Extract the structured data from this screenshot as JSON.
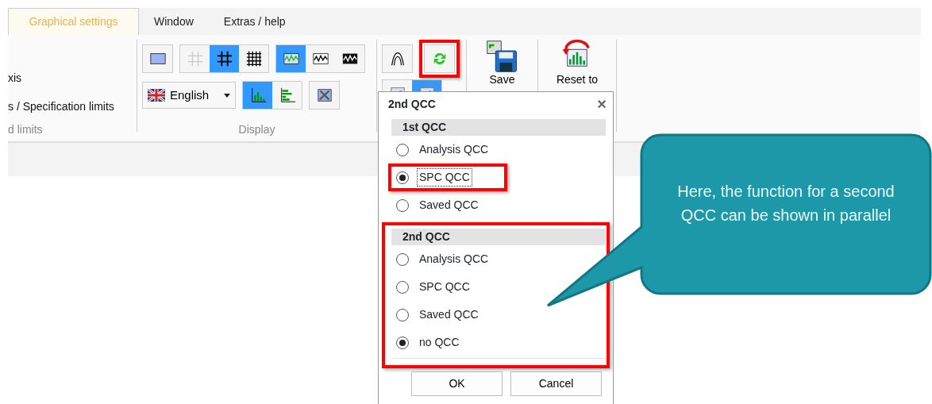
{
  "tabs": [
    {
      "label": "Graphical settings",
      "selected": true
    },
    {
      "label": "Window",
      "selected": false
    },
    {
      "label": "Extras / help",
      "selected": false
    }
  ],
  "ribbon": {
    "groups": [
      {
        "kind": "text",
        "lines": [
          "xis",
          "s / Specification limits"
        ],
        "label": "d limits"
      },
      {
        "kind": "display",
        "label": "Display",
        "rows": [
          [
            {
              "kind": "segment",
              "buttons": [
                {
                  "selected": false
                }
              ]
            },
            {
              "kind": "segment",
              "buttons": [
                {
                  "selected": false
                },
                {
                  "selected": true
                },
                {
                  "selected": false
                }
              ]
            },
            {
              "kind": "segment",
              "buttons": [
                {
                  "selected": true
                },
                {
                  "selected": false
                },
                {
                  "selected": false
                }
              ]
            }
          ],
          [
            {
              "kind": "dropdown",
              "value": "English"
            },
            {
              "kind": "segment",
              "buttons": [
                {
                  "selected": true
                },
                {
                  "selected": false
                }
              ]
            },
            {
              "kind": "segment",
              "buttons": [
                {
                  "selected": false
                }
              ]
            }
          ]
        ]
      },
      {
        "kind": "display",
        "rows": [
          [
            {
              "kind": "segment",
              "buttons": [
                {
                  "selected": false
                }
              ]
            },
            {
              "kind": "segment",
              "highlighted": true,
              "buttons": [
                {
                  "selected": false
                }
              ]
            }
          ],
          [
            {
              "kind": "segment",
              "buttons": [
                {
                  "selected": false
                },
                {
                  "selected": true
                }
              ]
            }
          ]
        ]
      },
      {
        "kind": "large",
        "label": "Save"
      },
      {
        "kind": "large",
        "label": "Reset to"
      }
    ]
  },
  "dialog": {
    "title": "2nd QCC",
    "close": "×",
    "sections": [
      {
        "heading": "1st QCC",
        "highlighted": false,
        "options": [
          {
            "label": "Analysis QCC",
            "selected": false,
            "highlighted": false,
            "focused": false
          },
          {
            "label": "SPC QCC",
            "selected": true,
            "highlighted": true,
            "focused": true
          },
          {
            "label": "Saved QCC",
            "selected": false,
            "highlighted": false,
            "focused": false
          }
        ]
      },
      {
        "heading": "2nd QCC",
        "highlighted": true,
        "options": [
          {
            "label": "Analysis QCC",
            "selected": false,
            "highlighted": false,
            "focused": false
          },
          {
            "label": "SPC QCC",
            "selected": false,
            "highlighted": false,
            "focused": false
          },
          {
            "label": "Saved QCC",
            "selected": false,
            "highlighted": false,
            "focused": false
          },
          {
            "label": "no QCC",
            "selected": true,
            "highlighted": false,
            "focused": false
          }
        ]
      }
    ],
    "buttons": [
      "OK",
      "Cancel"
    ]
  },
  "callout": {
    "text": "Here, the function for a second QCC can be shown in parallel"
  }
}
